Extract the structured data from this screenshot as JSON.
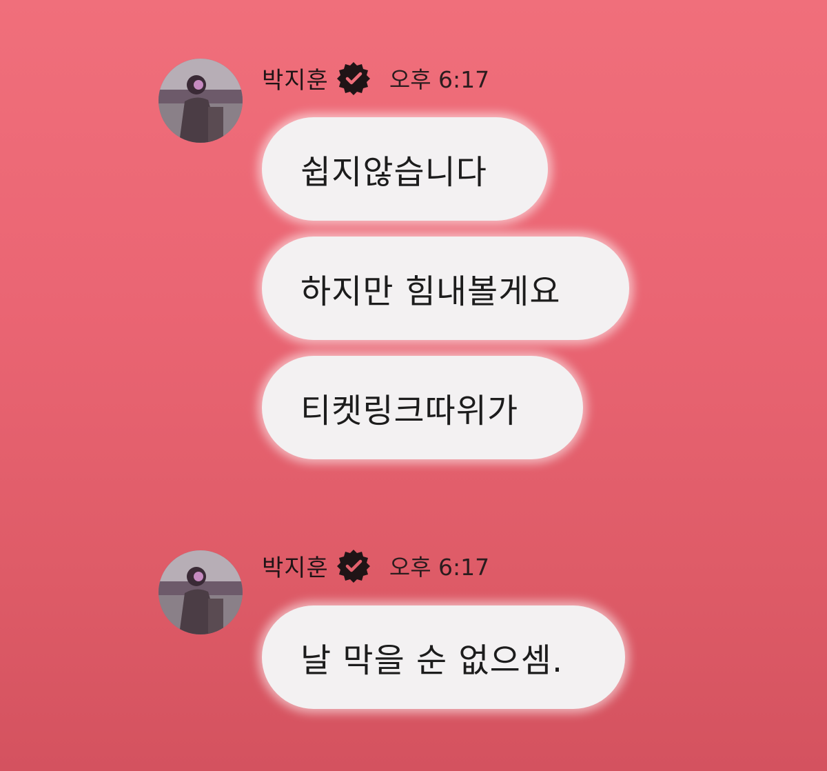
{
  "colors": {
    "background_top": "#f06f7b",
    "background_bottom": "#d4525f",
    "bubble": "#f3f1f2",
    "text": "#1c1c1c"
  },
  "messages": [
    {
      "sender": "박지훈",
      "verified_icon": "verified-badge-icon",
      "time": "오후 6:17",
      "bubbles": [
        "쉽지않습니다",
        "하지만 힘내볼게요",
        "티켓링크따위가"
      ]
    },
    {
      "sender": "박지훈",
      "verified_icon": "verified-badge-icon",
      "time": "오후 6:17",
      "bubbles": [
        "날 막을 순 없으셈."
      ]
    }
  ]
}
